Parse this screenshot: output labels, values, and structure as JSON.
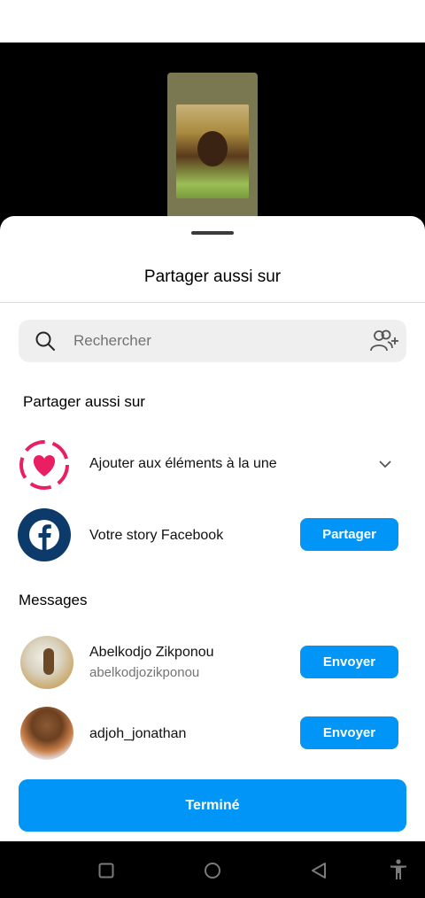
{
  "sheet": {
    "title": "Partager aussi sur"
  },
  "search": {
    "placeholder": "Rechercher"
  },
  "share_section": {
    "heading": "Partager aussi sur",
    "highlights": {
      "label": "Ajouter aux éléments à la une",
      "icon": "highlight-heart-icon",
      "accent": "#e91e63"
    },
    "facebook": {
      "label": "Votre story Facebook",
      "button": "Partager",
      "icon": "facebook-icon",
      "brand_color": "#0b3a6b"
    }
  },
  "messages": {
    "heading": "Messages",
    "contacts": [
      {
        "name": "Abelkodjo Zikponou",
        "username": "abelkodjozikponou",
        "button": "Envoyer"
      },
      {
        "name": "adjoh_jonathan",
        "username": "",
        "button": "Envoyer"
      }
    ]
  },
  "footer": {
    "done_label": "Terminé"
  },
  "colors": {
    "accent_blue": "#0095f6",
    "backdrop": "#000000"
  },
  "nav_icons": [
    "recents-square-icon",
    "home-circle-icon",
    "back-triangle-icon",
    "accessibility-icon"
  ]
}
